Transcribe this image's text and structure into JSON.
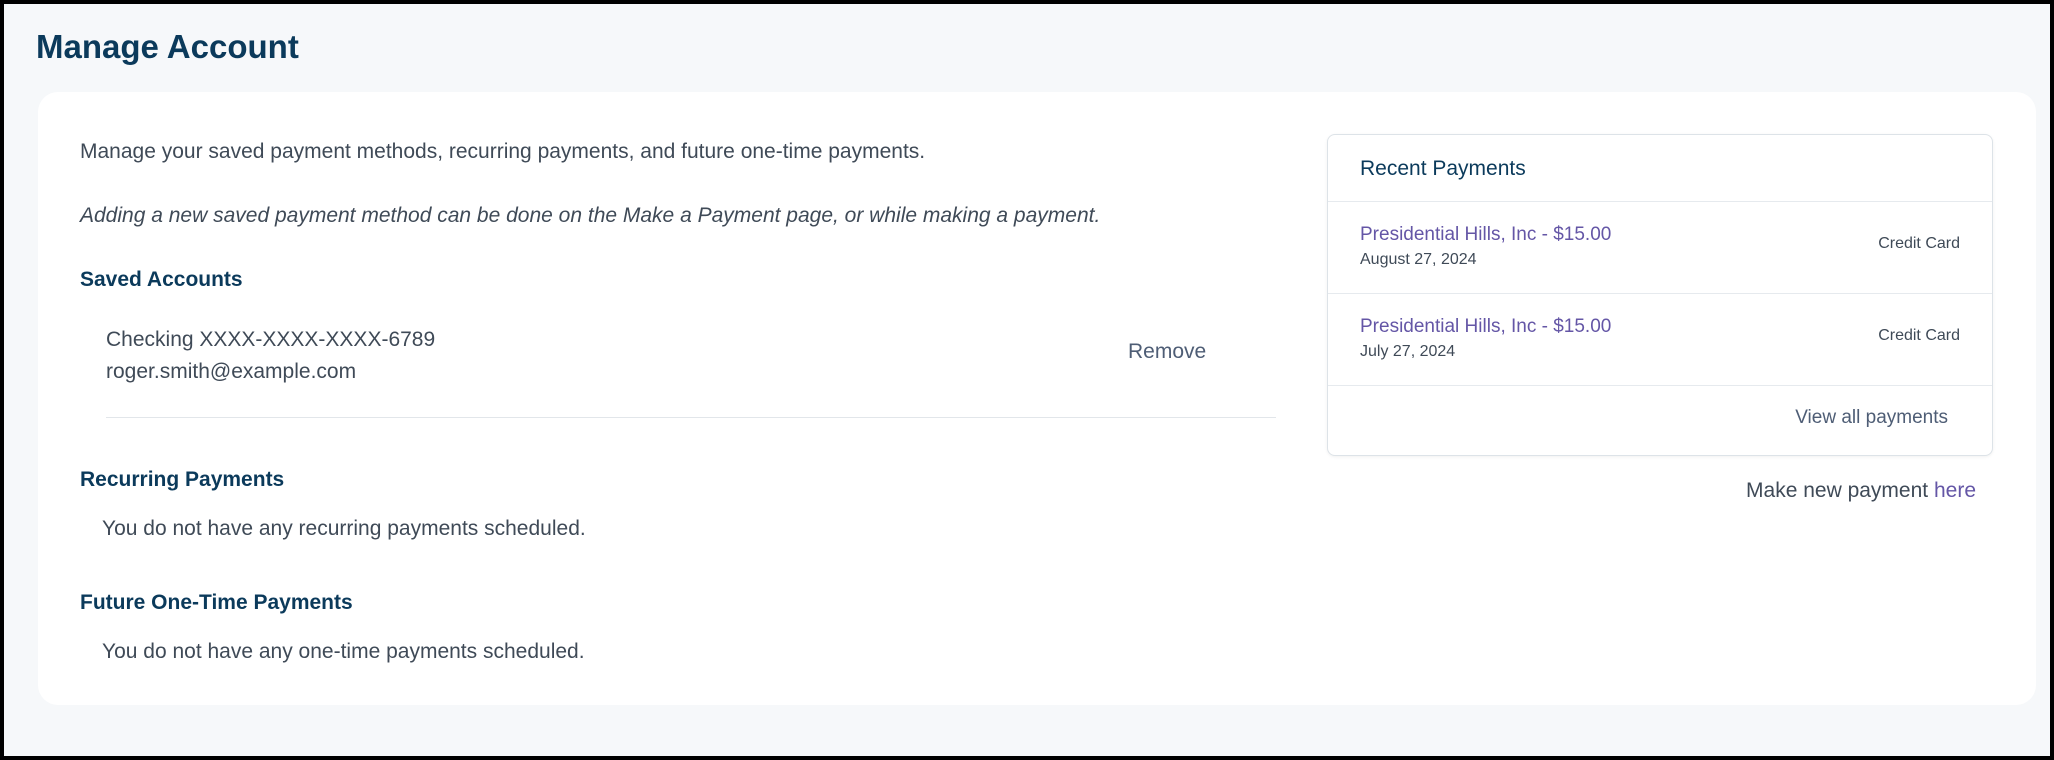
{
  "page": {
    "title": "Manage Account"
  },
  "intro": {
    "text": "Manage your saved payment methods, recurring payments, and future one-time payments.",
    "italic_text": "Adding a new saved payment method can be done on the Make a Payment page, or while making a payment."
  },
  "saved_accounts": {
    "heading": "Saved Accounts",
    "items": [
      {
        "title": "Checking XXXX-XXXX-XXXX-6789",
        "email": "roger.smith@example.com",
        "remove_label": "Remove"
      }
    ]
  },
  "recurring": {
    "heading": "Recurring Payments",
    "empty_text": "You do not have any recurring payments scheduled."
  },
  "future": {
    "heading": "Future One-Time Payments",
    "empty_text": "You do not have any one-time payments scheduled."
  },
  "recent_payments": {
    "title": "Recent Payments",
    "items": [
      {
        "label": "Presidential Hills, Inc - $15.00",
        "date": "August 27, 2024",
        "method": "Credit Card"
      },
      {
        "label": "Presidential Hills, Inc - $15.00",
        "date": "July 27, 2024",
        "method": "Credit Card"
      }
    ],
    "view_all_label": "View all payments"
  },
  "make_new": {
    "prefix": "Make new payment ",
    "link_label": "here"
  },
  "colors": {
    "heading": "#0b3a5b",
    "link": "#6456a6",
    "text": "#3f4a57",
    "background": "#f6f8fa"
  }
}
